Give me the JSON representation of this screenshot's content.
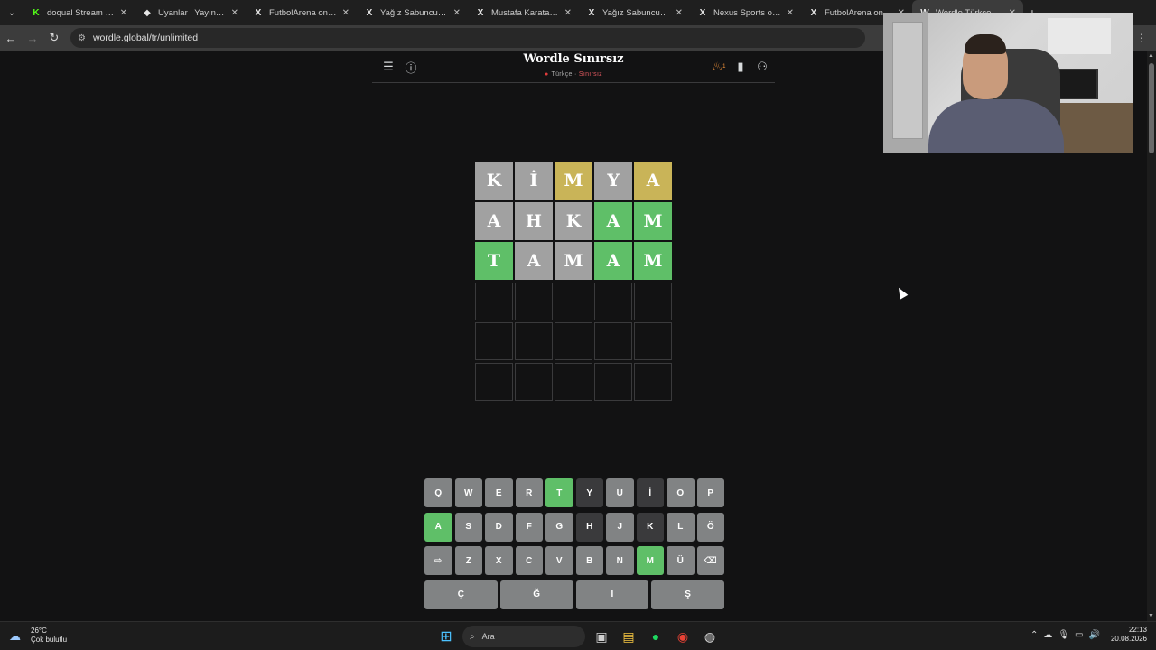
{
  "browser": {
    "tabs": [
      {
        "title": "doqual Stream - Wat",
        "icon": "kick-icon",
        "icon_glyph": "K",
        "icon_color": "#53fc18",
        "active": false
      },
      {
        "title": "Uyanlar | Yayınını güç",
        "icon": "diamond-icon",
        "icon_glyph": "◆",
        "icon_color": "#e6e6e6",
        "active": false
      },
      {
        "title": "FutbolArena on X: \"A",
        "icon": "x-icon",
        "icon_glyph": "X",
        "icon_color": "#e6e6e6",
        "active": false
      },
      {
        "title": "Yağız Sabuncuoğlu o",
        "icon": "x-icon",
        "icon_glyph": "X",
        "icon_color": "#e6e6e6",
        "active": false
      },
      {
        "title": "Mustafa Karataş on X",
        "icon": "x-icon",
        "icon_glyph": "X",
        "icon_color": "#e6e6e6",
        "active": false
      },
      {
        "title": "Yağız Sabuncuoğlu o",
        "icon": "x-icon",
        "icon_glyph": "X",
        "icon_color": "#e6e6e6",
        "active": false
      },
      {
        "title": "Nexus Sports on X: \"",
        "icon": "x-icon",
        "icon_glyph": "X",
        "icon_color": "#e6e6e6",
        "active": false
      },
      {
        "title": "FutbolArena on X: \"",
        "icon": "x-icon",
        "icon_glyph": "X",
        "icon_color": "#e6e6e6",
        "active": false
      },
      {
        "title": "Wordle Türkçe Sınırs",
        "icon": "wordle-icon",
        "icon_glyph": "W",
        "icon_color": "#e6e6e6",
        "active": true
      }
    ],
    "url": "wordle.global/tr/unlimited"
  },
  "game": {
    "title": "Wordle Sınırsız",
    "language": "Türkçe",
    "separator": "·",
    "mode": "Sınırsız",
    "streak_count": "1",
    "board": [
      [
        {
          "l": "K",
          "s": "absent"
        },
        {
          "l": "İ",
          "s": "absent"
        },
        {
          "l": "M",
          "s": "present"
        },
        {
          "l": "Y",
          "s": "absent"
        },
        {
          "l": "A",
          "s": "present"
        }
      ],
      [
        {
          "l": "A",
          "s": "absent"
        },
        {
          "l": "H",
          "s": "absent"
        },
        {
          "l": "K",
          "s": "absent"
        },
        {
          "l": "A",
          "s": "correct"
        },
        {
          "l": "M",
          "s": "correct"
        }
      ],
      [
        {
          "l": "T",
          "s": "correct"
        },
        {
          "l": "A",
          "s": "absent"
        },
        {
          "l": "M",
          "s": "absent"
        },
        {
          "l": "A",
          "s": "correct"
        },
        {
          "l": "M",
          "s": "correct"
        }
      ],
      [
        {
          "l": "",
          "s": "empty"
        },
        {
          "l": "",
          "s": "empty"
        },
        {
          "l": "",
          "s": "empty"
        },
        {
          "l": "",
          "s": "empty"
        },
        {
          "l": "",
          "s": "empty"
        }
      ],
      [
        {
          "l": "",
          "s": "empty"
        },
        {
          "l": "",
          "s": "empty"
        },
        {
          "l": "",
          "s": "empty"
        },
        {
          "l": "",
          "s": "empty"
        },
        {
          "l": "",
          "s": "empty"
        }
      ],
      [
        {
          "l": "",
          "s": "empty"
        },
        {
          "l": "",
          "s": "empty"
        },
        {
          "l": "",
          "s": "empty"
        },
        {
          "l": "",
          "s": "empty"
        },
        {
          "l": "",
          "s": "empty"
        }
      ]
    ],
    "keyboard": [
      [
        {
          "k": "Q",
          "s": "unused"
        },
        {
          "k": "W",
          "s": "unused"
        },
        {
          "k": "E",
          "s": "unused"
        },
        {
          "k": "R",
          "s": "unused"
        },
        {
          "k": "T",
          "s": "correct"
        },
        {
          "k": "Y",
          "s": "absent"
        },
        {
          "k": "U",
          "s": "unused"
        },
        {
          "k": "İ",
          "s": "absent"
        },
        {
          "k": "O",
          "s": "unused"
        },
        {
          "k": "P",
          "s": "unused"
        }
      ],
      [
        {
          "k": "A",
          "s": "correct"
        },
        {
          "k": "S",
          "s": "unused"
        },
        {
          "k": "D",
          "s": "unused"
        },
        {
          "k": "F",
          "s": "unused"
        },
        {
          "k": "G",
          "s": "unused"
        },
        {
          "k": "H",
          "s": "absent"
        },
        {
          "k": "J",
          "s": "unused"
        },
        {
          "k": "K",
          "s": "absent"
        },
        {
          "k": "L",
          "s": "unused"
        },
        {
          "k": "Ö",
          "s": "unused"
        }
      ],
      [
        {
          "k": "⇨",
          "s": "unused",
          "name": "enter-key"
        },
        {
          "k": "Z",
          "s": "unused"
        },
        {
          "k": "X",
          "s": "unused"
        },
        {
          "k": "C",
          "s": "unused"
        },
        {
          "k": "V",
          "s": "unused"
        },
        {
          "k": "B",
          "s": "unused"
        },
        {
          "k": "N",
          "s": "unused"
        },
        {
          "k": "M",
          "s": "correct"
        },
        {
          "k": "Ü",
          "s": "unused"
        },
        {
          "k": "⌫",
          "s": "unused",
          "name": "backspace-key"
        }
      ],
      [
        {
          "k": "Ç",
          "s": "unused",
          "wide": true
        },
        {
          "k": "Ğ",
          "s": "unused",
          "wide": true
        },
        {
          "k": "I",
          "s": "unused",
          "wide": true
        },
        {
          "k": "Ş",
          "s": "unused",
          "wide": true
        }
      ]
    ]
  },
  "colors": {
    "correct": "#5fbf68",
    "present": "#c9b458",
    "absent_tile": "#a1a1a1",
    "absent_key": "#3a3a3c",
    "background": "#121213"
  },
  "taskbar": {
    "temperature": "26°C",
    "weather_desc": "Çok bulutlu",
    "search_placeholder": "Ara",
    "time": "22:13",
    "date": "20.08.2026"
  }
}
